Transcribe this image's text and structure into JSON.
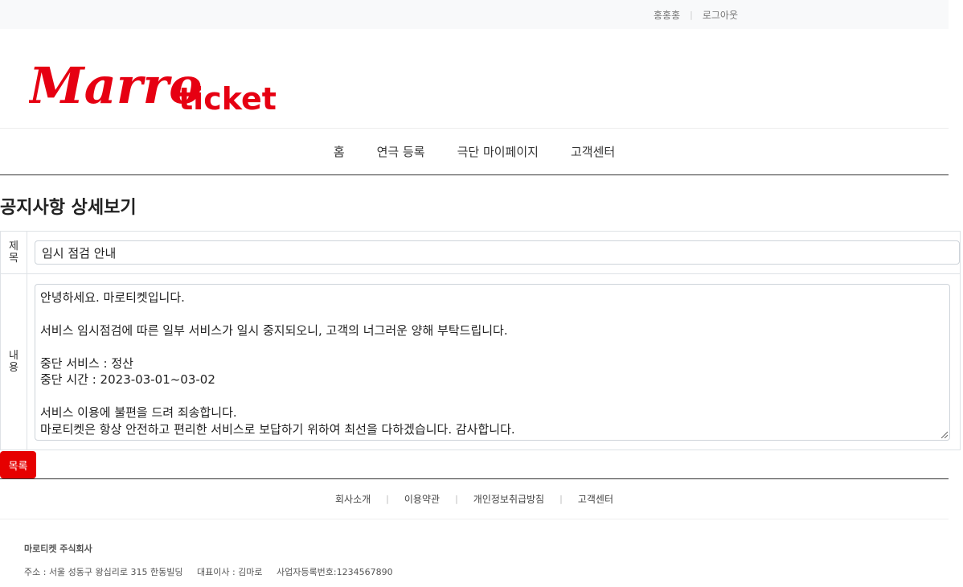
{
  "topbar": {
    "username": "홍홍홍",
    "logout": "로그아웃"
  },
  "logo": {
    "script_text": "Marro",
    "word_text": "ticket",
    "color": "#e60012"
  },
  "nav": {
    "items": [
      "홈",
      "연극 등록",
      "극단 마이페이지",
      "고객센터"
    ]
  },
  "page": {
    "title": "공지사항 상세보기"
  },
  "detail": {
    "title_label": "제목",
    "title_label_l1": "제",
    "title_label_l2": "목",
    "body_label": "내용",
    "body_label_l1": "내",
    "body_label_l2": "용",
    "title_value": "임시 점검 안내",
    "body_lines": [
      "안녕하세요. 마로티켓입니다.",
      "",
      "서비스 임시점검에 따른 일부 서비스가 일시 중지되오니, 고객의 너그러운 양해 부탁드립니다.",
      "",
      "중단 서비스 : 정산",
      "중단 시간 : 2023-03-01~03-02",
      "",
      "서비스 이용에 불편을 드려 죄송합니다.",
      "마로티켓은 항상 안전하고 편리한 서비스로 보답하기 위하여 최선을 다하겠습니다. 감사합니다."
    ]
  },
  "buttons": {
    "list_label": "목록",
    "list_color": "#e60000"
  },
  "footer": {
    "links": [
      "회사소개",
      "이용약관",
      "개인정보취급방침",
      "고객센터"
    ],
    "company_name": "마로티켓 주식회사",
    "address": "주소 : 서울 성동구 왕십리로 315 한동빌딩",
    "ceo": "대표이사 : 김마로",
    "business_no": "사업자등록번호:1234567890"
  }
}
